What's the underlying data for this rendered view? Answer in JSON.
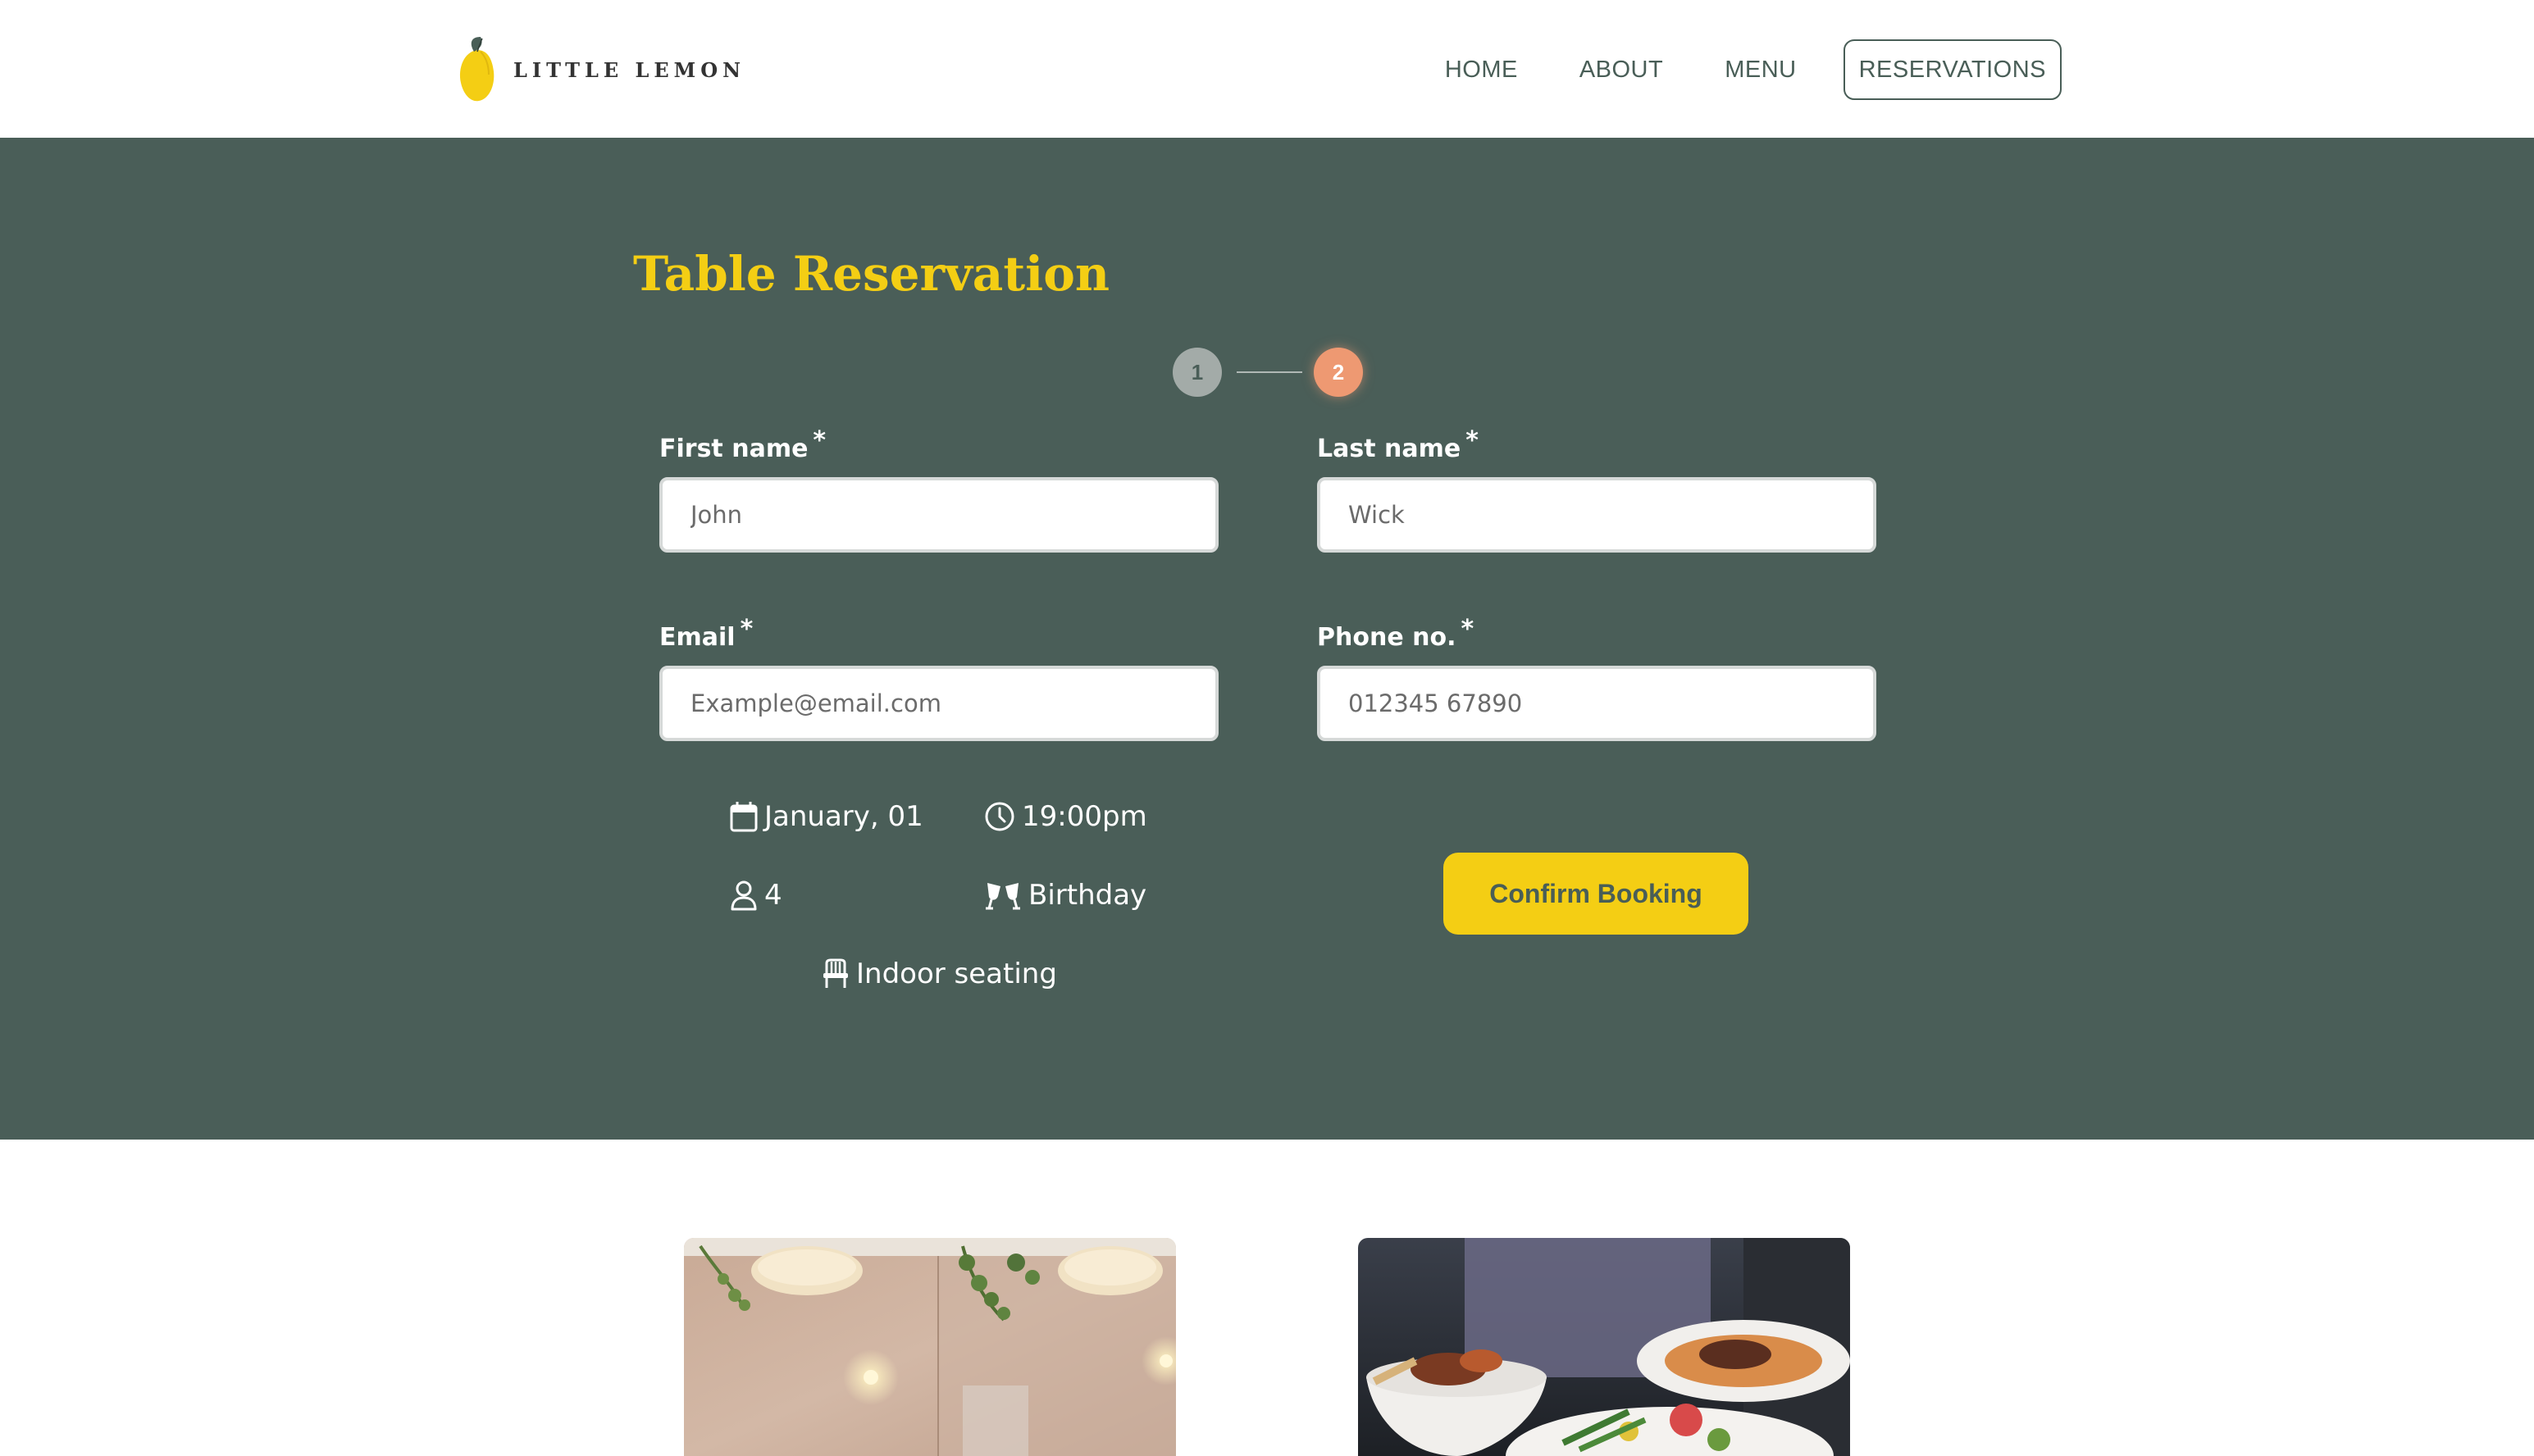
{
  "brand": {
    "name": "LITTLE LEMON",
    "logo_icon": "lemon-icon",
    "colors": {
      "primary": "#495e57",
      "accent": "#f4ce14",
      "step_active": "#ee9972",
      "step_inactive": "#a3aba8"
    }
  },
  "nav": {
    "items": [
      {
        "label": "HOME",
        "active": false
      },
      {
        "label": "ABOUT",
        "active": false
      },
      {
        "label": "MENU",
        "active": false
      },
      {
        "label": "RESERVATIONS",
        "active": true
      }
    ]
  },
  "form": {
    "title": "Table Reservation",
    "steps": [
      "1",
      "2"
    ],
    "current_step": 2,
    "required_marker": "*",
    "fields": {
      "first_name": {
        "label": "First name",
        "value": "",
        "placeholder": "John"
      },
      "last_name": {
        "label": "Last name",
        "value": "",
        "placeholder": "Wick"
      },
      "email": {
        "label": "Email",
        "value": "",
        "placeholder": "Example@email.com"
      },
      "phone": {
        "label": "Phone no.",
        "value": "",
        "placeholder": "012345 67890"
      }
    },
    "summary": {
      "date": {
        "icon": "calendar-icon",
        "text": "January, 01"
      },
      "time": {
        "icon": "clock-icon",
        "text": "19:00pm"
      },
      "guests": {
        "icon": "person-icon",
        "text": "4"
      },
      "occasion": {
        "icon": "cheers-icon",
        "text": "Birthday"
      },
      "seating": {
        "icon": "chair-icon",
        "text": "Indoor seating"
      }
    },
    "confirm_label": "Confirm Booking"
  },
  "gallery": {
    "images": [
      "restaurant-interior-photo",
      "plated-dishes-photo"
    ]
  }
}
